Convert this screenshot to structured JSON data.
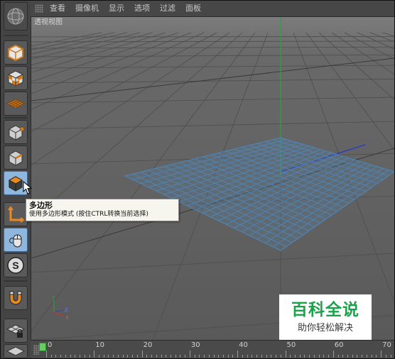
{
  "menubar": {
    "items": [
      "查看",
      "摄像机",
      "显示",
      "选项",
      "过滤",
      "面板"
    ]
  },
  "viewport": {
    "label": "透视视图",
    "axis_labels": [
      "Y",
      "Z",
      "X"
    ],
    "plane": {
      "color": "#4f83b3",
      "grid_divisions": 20
    }
  },
  "toolbar": {
    "tools": [
      {
        "name": "model-mode",
        "icon": "cube-outline-icon"
      },
      {
        "name": "texture-mode",
        "icon": "checker-cube-icon"
      },
      {
        "name": "workplane-mode",
        "icon": "grid-plane-icon"
      },
      {
        "name": "points-mode",
        "icon": "cube-points-icon"
      },
      {
        "name": "edges-mode",
        "icon": "cube-edges-icon"
      },
      {
        "name": "polygons-mode",
        "icon": "cube-polygons-icon",
        "active": true
      },
      {
        "name": "axis-mode",
        "icon": "axis-corner-icon"
      },
      {
        "name": "tweak-mode",
        "icon": "mouse-icon"
      },
      {
        "name": "snap-toggle",
        "icon": "snap-s-icon"
      },
      {
        "name": "magnet-tool",
        "icon": "magnet-icon"
      },
      {
        "name": "lock-workplane",
        "icon": "lock-grid-icon"
      },
      {
        "name": "grid-plane",
        "icon": "grid-icon"
      }
    ]
  },
  "tooltip": {
    "title": "多边形",
    "description": "使用多边形模式 (按住CTRL转换当前选择)"
  },
  "timeline": {
    "labels": [
      "0",
      "10",
      "20",
      "30",
      "40",
      "50",
      "60",
      "70"
    ],
    "current_frame": 0
  },
  "watermark": {
    "main": "百科全说",
    "sub": "助你轻松解决"
  },
  "colors": {
    "accent": "#8fb6dd",
    "plane": "#4f83b3",
    "y_axis": "#2ea043",
    "x_axis": "#2233cc",
    "watermark_green": "#1aa34a"
  }
}
